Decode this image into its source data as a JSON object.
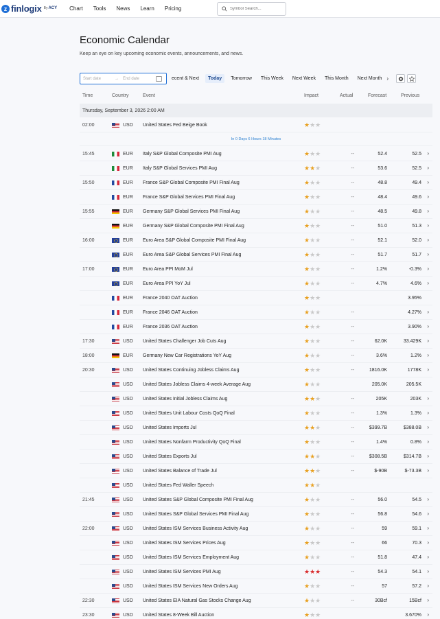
{
  "nav": {
    "logo": {
      "name": "finlogix",
      "by": "By",
      "brand": "ACY"
    },
    "items": [
      "Chart",
      "Tools",
      "News",
      "Learn",
      "Pricing"
    ],
    "search_placeholder": "Symbol Search..."
  },
  "header": {
    "title": "Economic Calendar",
    "subtitle": "Keep an eye on key upcoming economic events, announcements, and news."
  },
  "filters": {
    "start_placeholder": "Start date",
    "arrow": "→",
    "end_placeholder": "End date",
    "tabs": [
      "ecent & Next",
      "Today",
      "Tomorrow",
      "This Week",
      "Next Week",
      "This Month",
      "Next Month"
    ],
    "active_tab": "Today",
    "more_arrow": "›"
  },
  "table": {
    "columns": [
      "Time",
      "Country",
      "Event",
      "Impact",
      "Actual",
      "Forecast",
      "Previous"
    ],
    "day_header": "Thursday, September 3, 2026 2:00 AM",
    "countdown": "In 0 Days 6 Hours 18 Minutes",
    "chevron": "›",
    "rows": [
      {
        "time": "02:00",
        "flag": "us",
        "cur": "USD",
        "event": "United States Fed Beige Book",
        "impact": 1,
        "actual": "",
        "forecast": "",
        "previous": "",
        "chev": ""
      },
      {
        "time": "15:45",
        "flag": "it",
        "cur": "EUR",
        "event": "Italy S&P Global Composite PMI Aug",
        "impact": 1,
        "actual": "--",
        "forecast": "52.4",
        "previous": "52.5",
        "chev": "›"
      },
      {
        "time": "",
        "flag": "it",
        "cur": "EUR",
        "event": "Italy S&P Global Services PMI Aug",
        "impact": 2,
        "actual": "--",
        "forecast": "53.6",
        "previous": "52.5",
        "chev": "›"
      },
      {
        "time": "15:50",
        "flag": "fr",
        "cur": "EUR",
        "event": "France S&P Global Composite PMI Final Aug",
        "impact": 1,
        "actual": "--",
        "forecast": "48.8",
        "previous": "49.4",
        "chev": "›"
      },
      {
        "time": "",
        "flag": "fr",
        "cur": "EUR",
        "event": "France S&P Global Services PMI Final Aug",
        "impact": 1,
        "actual": "--",
        "forecast": "48.4",
        "previous": "49.6",
        "chev": "›"
      },
      {
        "time": "15:55",
        "flag": "de",
        "cur": "EUR",
        "event": "Germany S&P Global Services PMI Final Aug",
        "impact": 1,
        "actual": "--",
        "forecast": "48.5",
        "previous": "49.8",
        "chev": "›"
      },
      {
        "time": "",
        "flag": "de",
        "cur": "EUR",
        "event": "Germany S&P Global Composite PMI Final Aug",
        "impact": 1,
        "actual": "--",
        "forecast": "51.0",
        "previous": "51.3",
        "chev": "›"
      },
      {
        "time": "16:00",
        "flag": "eu",
        "cur": "EUR",
        "event": "Euro Area S&P Global Composite PMI Final Aug",
        "impact": 1,
        "actual": "--",
        "forecast": "52.1",
        "previous": "52.0",
        "chev": "›"
      },
      {
        "time": "",
        "flag": "eu",
        "cur": "EUR",
        "event": "Euro Area S&P Global Services PMI Final Aug",
        "impact": 1,
        "actual": "--",
        "forecast": "51.7",
        "previous": "51.7",
        "chev": "›"
      },
      {
        "time": "17:00",
        "flag": "eu",
        "cur": "EUR",
        "event": "Euro Area PPI MoM Jul",
        "impact": 1,
        "actual": "--",
        "forecast": "1.2%",
        "previous": "-0.3%",
        "chev": "›"
      },
      {
        "time": "",
        "flag": "eu",
        "cur": "EUR",
        "event": "Euro Area PPI YoY Jul",
        "impact": 1,
        "actual": "--",
        "forecast": "4.7%",
        "previous": "4.6%",
        "chev": "›"
      },
      {
        "time": "",
        "flag": "fr",
        "cur": "EUR",
        "event": "France 2040 OAT Auction",
        "impact": 1,
        "actual": "",
        "forecast": "",
        "previous": "3.95%",
        "chev": ""
      },
      {
        "time": "",
        "flag": "fr",
        "cur": "EUR",
        "event": "France 2046 OAT Auction",
        "impact": 1,
        "actual": "--",
        "forecast": "",
        "previous": "4.27%",
        "chev": "›"
      },
      {
        "time": "",
        "flag": "fr",
        "cur": "EUR",
        "event": "France 2036 OAT Auction",
        "impact": 1,
        "actual": "--",
        "forecast": "",
        "previous": "3.90%",
        "chev": "›"
      },
      {
        "time": "17:30",
        "flag": "us",
        "cur": "USD",
        "event": "United States Challenger Job Cuts Aug",
        "impact": 1,
        "actual": "--",
        "forecast": "62.0K",
        "previous": "33.429K",
        "chev": "›"
      },
      {
        "time": "18:00",
        "flag": "de",
        "cur": "EUR",
        "event": "Germany New Car Registrations YoY Aug",
        "impact": 1,
        "actual": "--",
        "forecast": "3.6%",
        "previous": "1.2%",
        "chev": "›"
      },
      {
        "time": "20:30",
        "flag": "us",
        "cur": "USD",
        "event": "United States Continuing Jobless Claims Aug",
        "impact": 1,
        "actual": "--",
        "forecast": "1816.0K",
        "previous": "1778K",
        "chev": "›"
      },
      {
        "time": "",
        "flag": "us",
        "cur": "USD",
        "event": "United States Jobless Claims 4-week Average Aug",
        "impact": 1,
        "actual": "",
        "forecast": "205.0K",
        "previous": "205.5K",
        "chev": ""
      },
      {
        "time": "",
        "flag": "us",
        "cur": "USD",
        "event": "United States Initial Jobless Claims Aug",
        "impact": 2,
        "actual": "--",
        "forecast": "205K",
        "previous": "203K",
        "chev": "›"
      },
      {
        "time": "",
        "flag": "us",
        "cur": "USD",
        "event": "United States Unit Labour Costs QoQ Final",
        "impact": 1,
        "actual": "--",
        "forecast": "1.3%",
        "previous": "1.3%",
        "chev": "›"
      },
      {
        "time": "",
        "flag": "us",
        "cur": "USD",
        "event": "United States Imports Jul",
        "impact": 2,
        "actual": "--",
        "forecast": "$399.7B",
        "previous": "$388.0B",
        "chev": "›"
      },
      {
        "time": "",
        "flag": "us",
        "cur": "USD",
        "event": "United States Nonfarm Productivity QoQ Final",
        "impact": 1,
        "actual": "--",
        "forecast": "1.4%",
        "previous": "0.8%",
        "chev": "›"
      },
      {
        "time": "",
        "flag": "us",
        "cur": "USD",
        "event": "United States Exports Jul",
        "impact": 2,
        "actual": "--",
        "forecast": "$308.5B",
        "previous": "$314.7B",
        "chev": "›"
      },
      {
        "time": "",
        "flag": "us",
        "cur": "USD",
        "event": "United States Balance of Trade Jul",
        "impact": 2,
        "actual": "--",
        "forecast": "$-90B",
        "previous": "$-73.3B",
        "chev": "›"
      },
      {
        "time": "",
        "flag": "us",
        "cur": "USD",
        "event": "United States Fed Waller Speech",
        "impact": 2,
        "actual": "",
        "forecast": "",
        "previous": "",
        "chev": ""
      },
      {
        "time": "21:45",
        "flag": "us",
        "cur": "USD",
        "event": "United States S&P Global Composite PMI Final Aug",
        "impact": 1,
        "actual": "--",
        "forecast": "56.0",
        "previous": "54.5",
        "chev": "›"
      },
      {
        "time": "",
        "flag": "us",
        "cur": "USD",
        "event": "United States S&P Global Services PMI Final Aug",
        "impact": 1,
        "actual": "--",
        "forecast": "56.8",
        "previous": "54.6",
        "chev": "›"
      },
      {
        "time": "22:00",
        "flag": "us",
        "cur": "USD",
        "event": "United States ISM Services Business Activity Aug",
        "impact": 1,
        "actual": "--",
        "forecast": "59",
        "previous": "59.1",
        "chev": "›"
      },
      {
        "time": "",
        "flag": "us",
        "cur": "USD",
        "event": "United States ISM Services Prices Aug",
        "impact": 1,
        "actual": "--",
        "forecast": "66",
        "previous": "70.3",
        "chev": "›"
      },
      {
        "time": "",
        "flag": "us",
        "cur": "USD",
        "event": "United States ISM Services Employment Aug",
        "impact": 1,
        "actual": "--",
        "forecast": "51.8",
        "previous": "47.4",
        "chev": "›"
      },
      {
        "time": "",
        "flag": "us",
        "cur": "USD",
        "event": "United States ISM Services PMI Aug",
        "impact": 3,
        "actual": "--",
        "forecast": "54.3",
        "previous": "54.1",
        "chev": "›"
      },
      {
        "time": "",
        "flag": "us",
        "cur": "USD",
        "event": "United States ISM Services New Orders Aug",
        "impact": 1,
        "actual": "--",
        "forecast": "57",
        "previous": "57.2",
        "chev": "›"
      },
      {
        "time": "22:30",
        "flag": "us",
        "cur": "USD",
        "event": "United States EIA Natural Gas Stocks Change Aug",
        "impact": 1,
        "actual": "--",
        "forecast": "30Bcf",
        "previous": "15Bcf",
        "chev": "›"
      },
      {
        "time": "23:30",
        "flag": "us",
        "cur": "USD",
        "event": "United States 8-Week Bill Auction",
        "impact": 1,
        "actual": "",
        "forecast": "",
        "previous": "3.670%",
        "chev": "›"
      }
    ]
  },
  "colors": {
    "accent": "#1f6fd6",
    "star_on": "#e8a020",
    "star_high": "#d92c2c",
    "star_off": "#c8c8c8"
  }
}
